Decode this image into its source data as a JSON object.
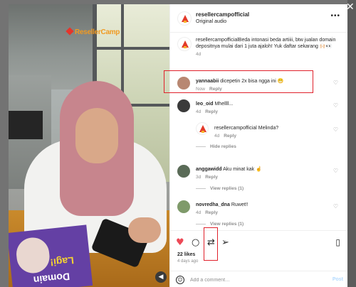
{
  "post": {
    "username": "resellercampofficial",
    "audio": "Original audio",
    "more_icon": "•••",
    "brand_text": "ResellerCamp",
    "flyer_line1": "Lagi!",
    "flyer_line2": "Domain"
  },
  "caption": {
    "username": "resellercampofficial",
    "text": "Beda intonasi beda artiiii, btw jualan domain depositnya mulai dari 1 juta ajaloh! Yuk daftar sekarang 🙌🏻👀",
    "time": "4d"
  },
  "comments": [
    {
      "username": "yannaabii",
      "text": "dicepetin 2x bisa ngga ini 😁",
      "time": "Now",
      "reply": "Reply",
      "avatar_color": "#b88772"
    },
    {
      "username": "leo_oid",
      "text": "Mhellll...",
      "time": "4d",
      "reply": "Reply",
      "avatar_color": "#3a3a3a"
    },
    {
      "username": "resellercampofficial",
      "text": "Melinda?",
      "time": "4d",
      "reply": "Reply"
    },
    {
      "username": "anggawidd",
      "text": "Aku minat kak ☝️",
      "time": "3d",
      "reply": "Reply",
      "avatar_color": "#5a6b57"
    },
    {
      "username": "novredha_dna",
      "text": "Ruwet!!",
      "time": "4d",
      "reply": "Reply",
      "avatar_color": "#7f9a6a"
    }
  ],
  "hide_replies": "Hide replies",
  "view_replies_1": "View replies (1)",
  "view_replies_2": "View replies (1)",
  "likes": "22 likes",
  "posted": "4 days ago",
  "composer": {
    "placeholder": "Add a comment…",
    "post_label": "Post"
  },
  "colors": {
    "like": "#ed4956",
    "highlight": "#e0212b",
    "brand_orange": "#f09a22"
  }
}
